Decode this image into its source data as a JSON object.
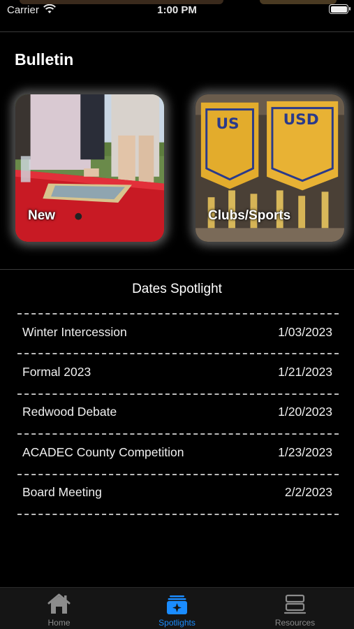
{
  "status_bar": {
    "carrier": "Carrier",
    "time": "1:00 PM"
  },
  "bulletin": {
    "title": "Bulletin",
    "cards": [
      {
        "label": "New"
      },
      {
        "label": "Clubs/Sports"
      }
    ]
  },
  "spotlight": {
    "title": "Dates Spotlight",
    "events": [
      {
        "name": "Winter Intercession",
        "date": "1/03/2023"
      },
      {
        "name": "Formal 2023",
        "date": "1/21/2023"
      },
      {
        "name": "Redwood Debate",
        "date": "1/20/2023"
      },
      {
        "name": "ACADEC County Competition",
        "date": "1/23/2023"
      },
      {
        "name": "Board Meeting",
        "date": "2/2/2023"
      }
    ]
  },
  "tab_bar": {
    "tabs": [
      {
        "label": "Home",
        "icon": "home-icon",
        "active": false
      },
      {
        "label": "Spotlights",
        "icon": "spotlights-icon",
        "active": true
      },
      {
        "label": "Resources",
        "icon": "resources-icon",
        "active": false
      }
    ],
    "active_color": "#1a8cff",
    "inactive_color": "#8c8c8c"
  }
}
